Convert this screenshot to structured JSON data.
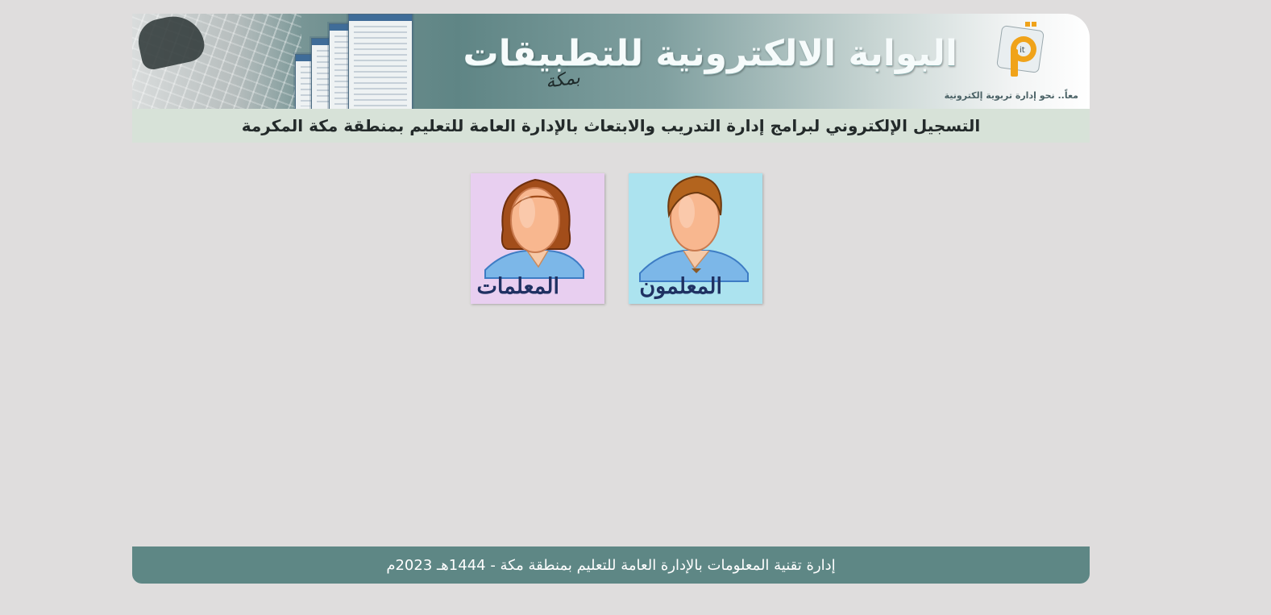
{
  "header": {
    "banner_title": "البوابة الالكترونية للتطبيقات",
    "banner_city": "بمكة",
    "banner_tagline": "معاً.. نحو إدارة تربوية إلكترونية",
    "logo_icon": "it-logo-icon",
    "subtitle": "التسجيل الإلكتروني لبرامج إدارة التدريب والابتعاث بالإدارة العامة للتعليم بمنطقة مكة المكرمة"
  },
  "choices": {
    "male": {
      "label": "المعلمون",
      "icon": "male-teacher-avatar-icon",
      "color": "#ace3ef"
    },
    "female": {
      "label": "المعلمات",
      "icon": "female-teacher-avatar-icon",
      "color": "#e8cff0"
    }
  },
  "footer": {
    "text": "إدارة تقنية المعلومات بالإدارة العامة للتعليم بمنطقة مكة - 1444هـ 2023م"
  },
  "colors": {
    "page_background": "#dfdddd",
    "subtitle_bar": "#d7e2d8",
    "footer_background": "#5e8785",
    "label_text": "#1f3162"
  }
}
